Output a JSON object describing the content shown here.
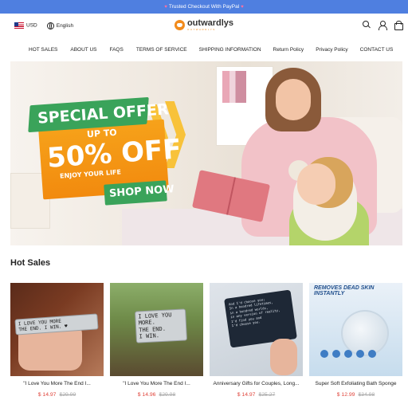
{
  "announcement": {
    "text": "Trusted Checkout With PayPal",
    "heart": "♥"
  },
  "header": {
    "currency": "USD",
    "language": "English",
    "logo": {
      "name": "outwardlys",
      "subtitle": "OUTWARDLYS"
    },
    "icons": [
      "search-icon",
      "user-icon",
      "cart-icon"
    ]
  },
  "nav": {
    "items": [
      "HOT SALES",
      "ABOUT US",
      "FAQS",
      "TERMS OF SERVICE",
      "SHIPPING INFORMATION",
      "Return Policy",
      "Privacy Policy",
      "CONTACT US"
    ]
  },
  "hero": {
    "line1": "SPECIAL OFFER",
    "line2": "UP TO",
    "line3": "50% OFF",
    "line4": "ENJOY YOUR LIFE",
    "cta": "SHOP NOW"
  },
  "section": {
    "title": "Hot Sales"
  },
  "products": [
    {
      "title": "\"I Love You More The End I...",
      "price": "$ 14.97",
      "compare": "$29.99",
      "image_text": "I LOVE YOU MORE\nTHE END. I WIN. ♥"
    },
    {
      "title": "\"I Love You More The End I...",
      "price": "$ 14.96",
      "compare": "$29.98",
      "image_text": "I LOVE YOU\nMORE.\nTHE END.\nI WIN."
    },
    {
      "title": "Anniversary Gifts for Couples, Long...",
      "price": "$ 14.97",
      "compare": "$25.27",
      "image_text": "And I'd choose you;\nIn a hundred lifetimes,\nin a hundred worlds,\nin any version of reality,\nI'd find you and\nI'd choose you."
    },
    {
      "title": "Super Soft Exfoliating Bath Sponge",
      "price": "$ 12.99",
      "compare": "$34.98",
      "image_text": "REMOVES DEAD SKIN\nINSTANTLY"
    }
  ],
  "colors": {
    "announce_bg": "#4f7fe0",
    "price": "#e0443b",
    "promo_green": "#3aa35a",
    "promo_orange": "#f28a0e"
  }
}
